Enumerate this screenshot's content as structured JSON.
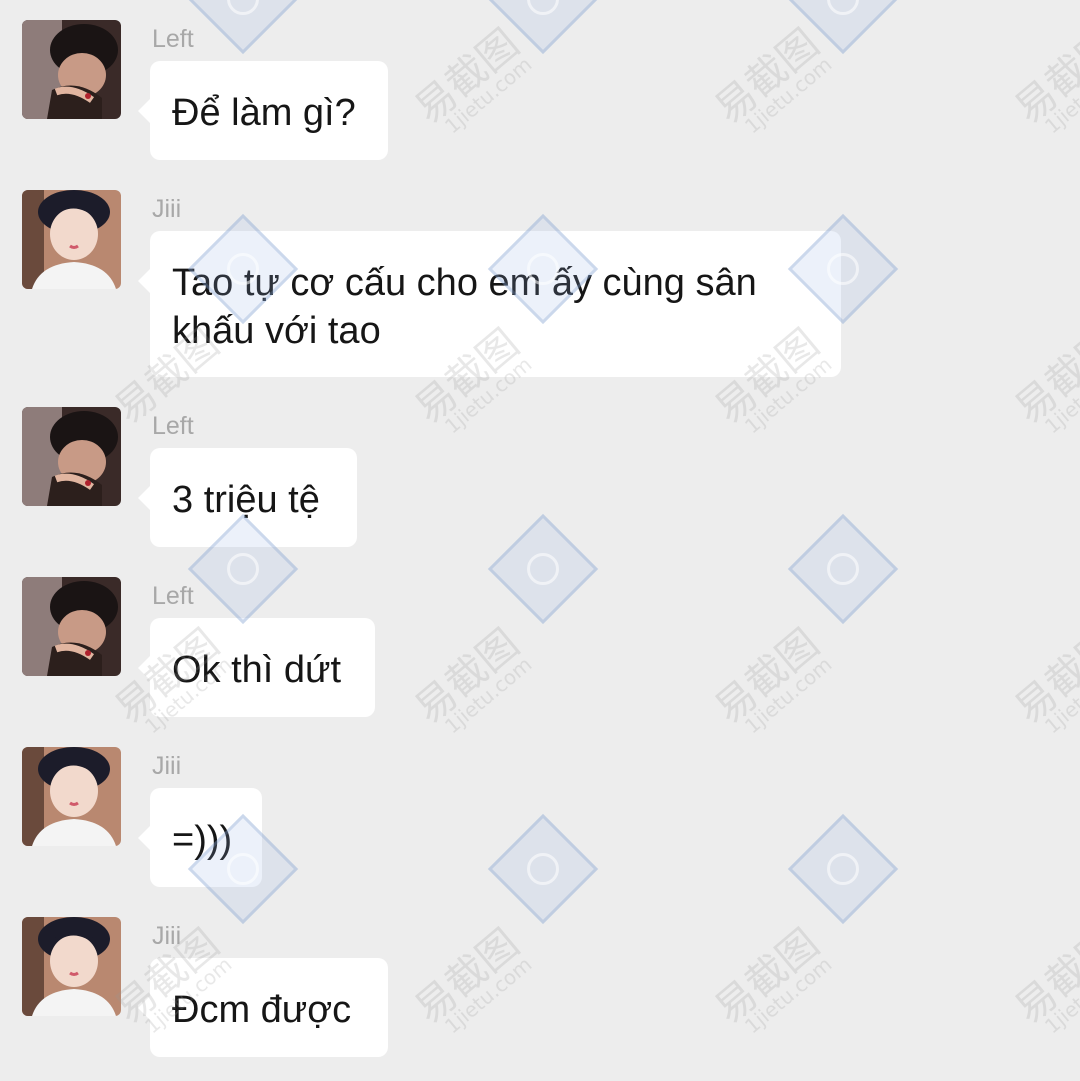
{
  "messages": [
    {
      "sender": "Left",
      "text": "Để làm gì?",
      "avatar": "avatar-left"
    },
    {
      "sender": "Jiii",
      "text": "Tao tự cơ cấu cho em ấy cùng sân\nkhấu với tao",
      "avatar": "avatar-jiii"
    },
    {
      "sender": "Left",
      "text": "3 triệu tệ",
      "avatar": "avatar-left"
    },
    {
      "sender": "Left",
      "text": "Ok thì dứt",
      "avatar": "avatar-left"
    },
    {
      "sender": "Jiii",
      "text": "=)))",
      "avatar": "avatar-jiii"
    },
    {
      "sender": "Jiii",
      "text": "Đcm được",
      "avatar": "avatar-jiii"
    }
  ],
  "watermark": {
    "cn": "易截图",
    "url": "1jietu.com"
  },
  "colors": {
    "background": "#ededed",
    "bubble": "#ffffff",
    "sender": "#a8a8a8",
    "text": "#161616"
  }
}
